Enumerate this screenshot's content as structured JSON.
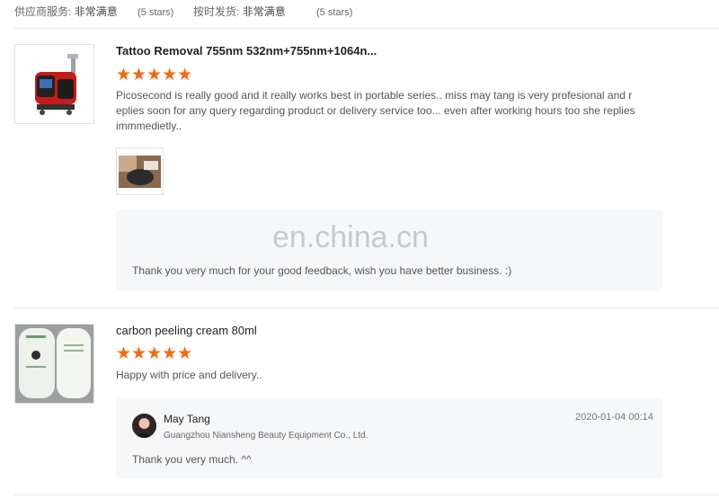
{
  "ratings": [
    {
      "label": "供应商服务:",
      "value": "非常满意",
      "stars_text": "(5 stars)"
    },
    {
      "label": "按时发货:",
      "value": "非常满意",
      "stars_text": "(5 stars)"
    }
  ],
  "reviews": [
    {
      "product_name": "Tattoo Removal 755nm 532nm+755nm+1064n...",
      "stars": "★★★★★",
      "rating": 5,
      "comment": "Picosecond is really good and it really works best in portable series.. miss may tang  is very profesional and replies  soon for any query regarding product or delivery service too... even after working hours too she replies immmedietly..",
      "watermark": "en.china.cn",
      "reply": "Thank you very much for your good feedback, wish you have better business. :)"
    },
    {
      "product_name": "carbon peeling cream 80ml",
      "stars": "★★★★★",
      "rating": 5,
      "comment": "Happy with price and delivery..",
      "seller_name": "May Tang",
      "seller_company": "Guangzhou Niansheng Beauty Equipment Co., Ltd.",
      "reply_date": "2020-01-04 00:14",
      "reply": "Thank you very much. ^^"
    }
  ],
  "colors": {
    "star": "#f26a10",
    "reply_bg": "#f6f7f9",
    "divider": "#e5e5e5"
  }
}
